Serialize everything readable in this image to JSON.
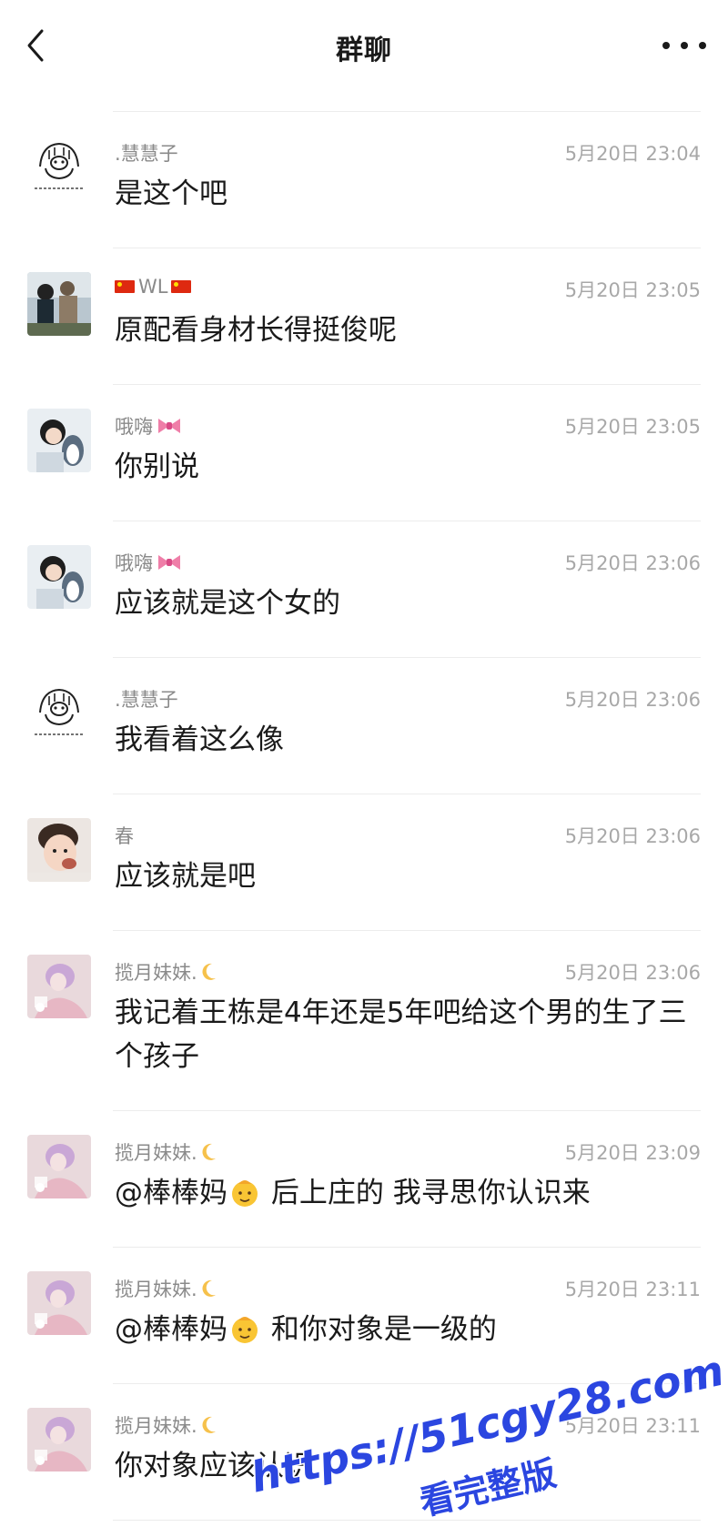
{
  "header": {
    "title": "群聊",
    "back_icon": "back-chevron-icon",
    "more_icon": "more-dots-icon"
  },
  "messages": [
    {
      "sender": ".慧慧子",
      "time": "5月20日 23:04",
      "text": "是这个吧",
      "avatar": "sketch-dog-avatar"
    },
    {
      "sender": "WL",
      "time": "5月20日 23:05",
      "text": "原配看身材长得挺俊呢",
      "avatar": "people-photo-avatar",
      "flags": "china-flag-icon"
    },
    {
      "sender": "哦嗨",
      "time": "5月20日 23:05",
      "text": "你别说",
      "avatar": "girl-penguin-avatar",
      "decor": "pink-bow-icon"
    },
    {
      "sender": "哦嗨",
      "time": "5月20日 23:06",
      "text": "应该就是这个女的",
      "avatar": "girl-penguin-avatar",
      "decor": "pink-bow-icon"
    },
    {
      "sender": ".慧慧子",
      "time": "5月20日 23:06",
      "text": "我看着这么像",
      "avatar": "sketch-dog-avatar"
    },
    {
      "sender": "春",
      "time": "5月20日 23:06",
      "text": "应该就是吧",
      "avatar": "baby-photo-avatar"
    },
    {
      "sender": "揽月妹妹.",
      "time": "5月20日 23:06",
      "text": "我记着王栋是4年还是5年吧给这个男的生了三个孩子",
      "avatar": "pink-anime-avatar",
      "decor": "moon-icon"
    },
    {
      "sender": "揽月妹妹.",
      "time": "5月20日 23:09",
      "text_a": "@棒棒妈",
      "text_b": " 后上庄的 我寻思你认识来",
      "avatar": "pink-anime-avatar",
      "decor": "moon-icon",
      "emoji": "baby-face-emoji"
    },
    {
      "sender": "揽月妹妹.",
      "time": "5月20日 23:11",
      "text_a": "@棒棒妈",
      "text_b": " 和你对象是一级的",
      "avatar": "pink-anime-avatar",
      "decor": "moon-icon",
      "emoji": "baby-face-emoji"
    },
    {
      "sender": "揽月妹妹.",
      "time": "5月20日 23:11",
      "text": "你对象应该认识",
      "avatar": "pink-anime-avatar",
      "decor": "moon-icon"
    }
  ],
  "watermark": {
    "url_text": "https://51cgy28.com",
    "caption": "看完整版"
  },
  "colors": {
    "text": "#1a1a1a",
    "sender": "#8a8a8a",
    "time": "#a8a8a8",
    "divider": "#ececec",
    "watermark": "#2b46e0"
  }
}
